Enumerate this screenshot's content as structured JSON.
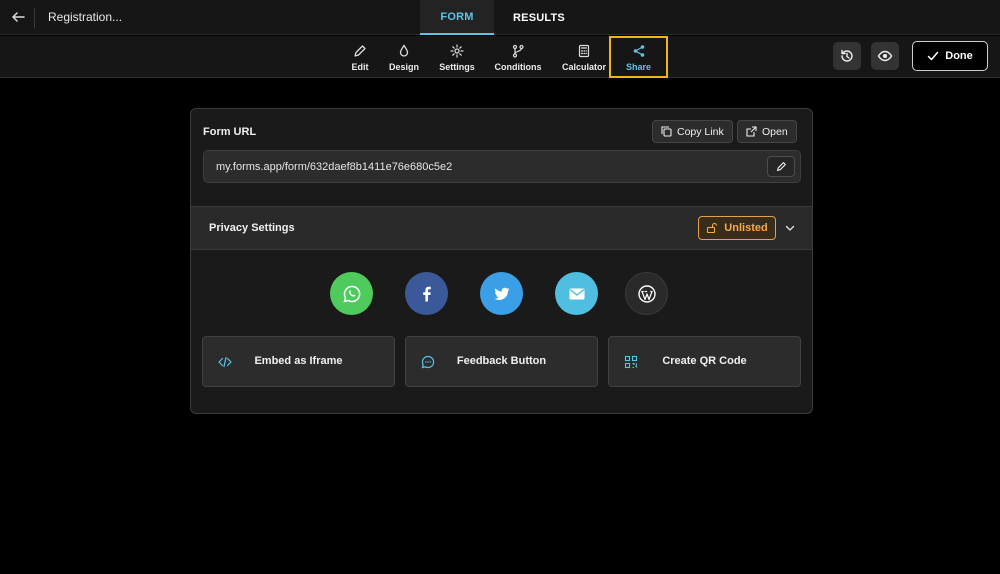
{
  "header": {
    "title": "Registration...",
    "tabs": [
      {
        "label": "FORM",
        "active": true
      },
      {
        "label": "RESULTS",
        "active": false
      }
    ]
  },
  "toolbar": {
    "tools": [
      {
        "label": "Edit",
        "icon": "pencil-icon"
      },
      {
        "label": "Design",
        "icon": "droplet-icon"
      },
      {
        "label": "Settings",
        "icon": "gear-icon"
      },
      {
        "label": "Conditions",
        "icon": "branch-icon"
      },
      {
        "label": "Calculator",
        "icon": "calculator-icon"
      },
      {
        "label": "Share",
        "icon": "share-icon",
        "active": true
      }
    ],
    "done_label": "Done"
  },
  "share": {
    "url_label": "Form URL",
    "copy_link_label": "Copy Link",
    "open_label": "Open",
    "url_value": "my.forms.app/form/632daef8b1411e76e680c5e2",
    "privacy_label": "Privacy Settings",
    "privacy_value": "Unlisted",
    "social": [
      {
        "name": "whatsapp",
        "color": "#4fca5c"
      },
      {
        "name": "facebook",
        "color": "#3b5998"
      },
      {
        "name": "twitter",
        "color": "#3a9fe6"
      },
      {
        "name": "email",
        "color": "#4fbee0"
      },
      {
        "name": "wordpress",
        "color": "#2a2a2a"
      }
    ],
    "actions": [
      {
        "label": "Embed as Iframe",
        "icon": "code-icon"
      },
      {
        "label": "Feedback Button",
        "icon": "chat-icon"
      },
      {
        "label": "Create QR Code",
        "icon": "qr-code-icon"
      }
    ]
  },
  "colors": {
    "accent": "#5cc4e6",
    "highlight": "#f1b514",
    "unlisted": "#f3aa4a"
  }
}
